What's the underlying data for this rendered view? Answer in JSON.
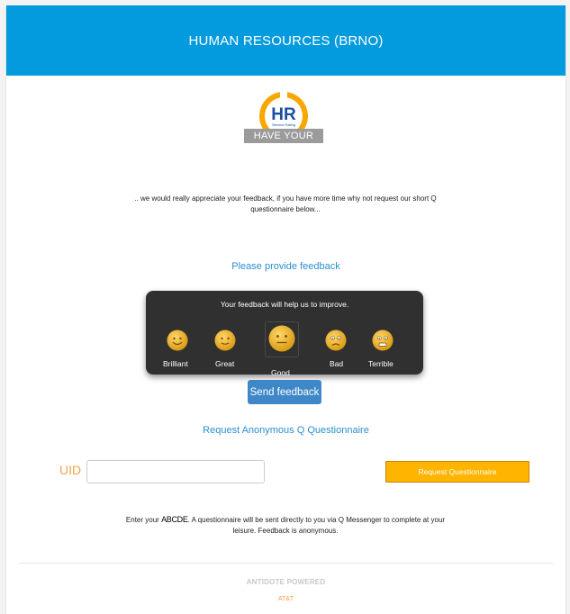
{
  "header": {
    "title": "HUMAN RESOURCES (BRNO)"
  },
  "logo": {
    "main_text": "HR",
    "sub_text": "Service Rating",
    "caption": "HAVE YOUR SAY"
  },
  "intro": {
    "line1": ".. we would really appreciate your feedback, if you have more time why not request our short Q",
    "line2": "questionnaire below..."
  },
  "feedback": {
    "heading": "Please provide feedback",
    "panel_title": "Your feedback will help us to improve.",
    "options": [
      {
        "label": "Brilliant",
        "icon": "happy-face-icon"
      },
      {
        "label": "Great",
        "icon": "smiling-face-icon"
      },
      {
        "label": "Good",
        "icon": "neutral-face-icon",
        "selected": true
      },
      {
        "label": "Bad",
        "icon": "unhappy-face-icon"
      },
      {
        "label": "Terrible",
        "icon": "angry-face-icon"
      }
    ],
    "send_label": "Send feedback"
  },
  "questionnaire": {
    "link_label": "Request Anonymous Q Questionnaire",
    "uid_label": "UID",
    "uid_value": "",
    "button_label": "Request Questionnaire"
  },
  "note": {
    "prefix": "Enter your ",
    "code": "ABCDE",
    "suffix": ". A questionnaire will be sent directly to you via Q Messenger to complete at your",
    "line2": "leisure. Feedback is anonymous."
  },
  "footer": {
    "powered": "ANTIDOTE POWERED",
    "brand": "AT&T"
  },
  "colors": {
    "header": "#039ade",
    "accent_link": "#2a8fd0",
    "orange": "#ffb400",
    "uid": "#f0a24a"
  }
}
